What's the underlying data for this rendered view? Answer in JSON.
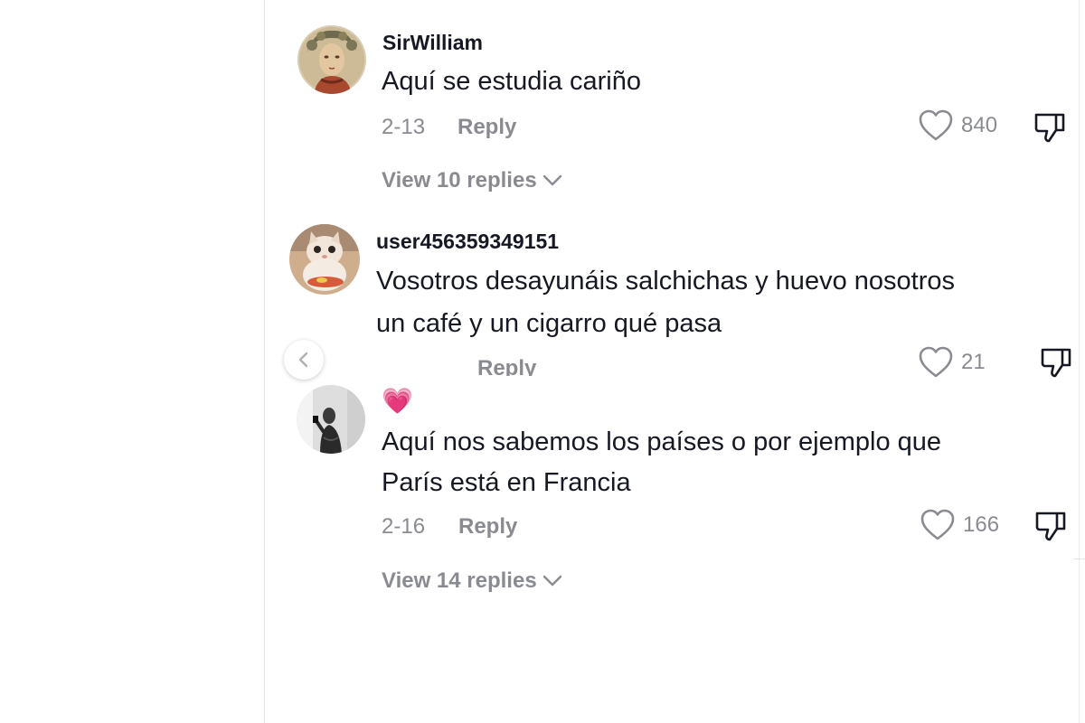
{
  "comments": [
    {
      "username": "SirWilliam",
      "text": "Aquí se estudia cariño",
      "date": "2-13",
      "reply_label": "Reply",
      "likes": "840",
      "view_replies": "View 10 replies",
      "avatar": "mosaic-portrait-avatar"
    },
    {
      "username": "user456359349151",
      "text_line1": "Vosotros desayunáis salchichas y huevo nosotros",
      "text_line2": "un café y un cigarro qué pasa",
      "reply_label": "Reply",
      "likes": "21",
      "avatar": "cat-avatar"
    },
    {
      "username": "💗",
      "text_line1": "Aquí nos sabemos los países o por ejemplo que",
      "text_line2": "París está en Francia",
      "date": "2-16",
      "reply_label": "Reply",
      "likes": "166",
      "view_replies": "View 14 replies",
      "avatar": "mirror-selfie-avatar"
    }
  ],
  "icons": {
    "like": "heart-outline-icon",
    "dislike": "thumbs-down-icon",
    "expand": "chevron-down-icon",
    "prev": "chevron-left-icon"
  },
  "colors": {
    "text": "#161823",
    "muted": "#8a8b91",
    "divider": "#e3e3e4"
  }
}
